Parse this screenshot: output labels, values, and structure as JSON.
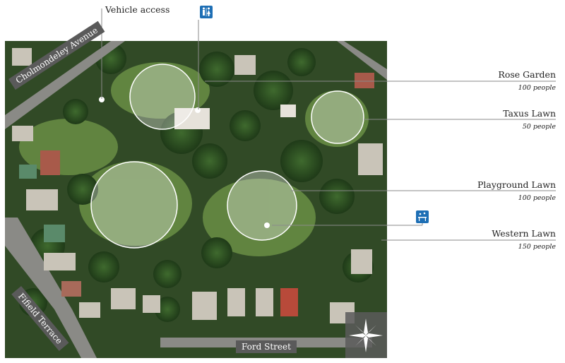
{
  "labels": {
    "vehicle_access": "Vehicle access"
  },
  "lawns": [
    {
      "name": "Rose Garden",
      "capacity": "100 people"
    },
    {
      "name": "Taxus Lawn",
      "capacity": "50 people"
    },
    {
      "name": "Playground Lawn",
      "capacity": "100 people"
    },
    {
      "name": "Western Lawn",
      "capacity": "150 people"
    }
  ],
  "streets": {
    "cholmondeley": "Cholmondeley Avenue",
    "fifield": "Fifield Terrace",
    "ford": "Ford Street"
  },
  "icons": {
    "toilets": "toilets-icon",
    "playground": "playground-icon",
    "compass": "compass-rose-icon"
  },
  "colors": {
    "icon_blue": "#1e6fb5",
    "street_label_bg": "#5a5a5a",
    "circle_fill": "#ffffff"
  }
}
